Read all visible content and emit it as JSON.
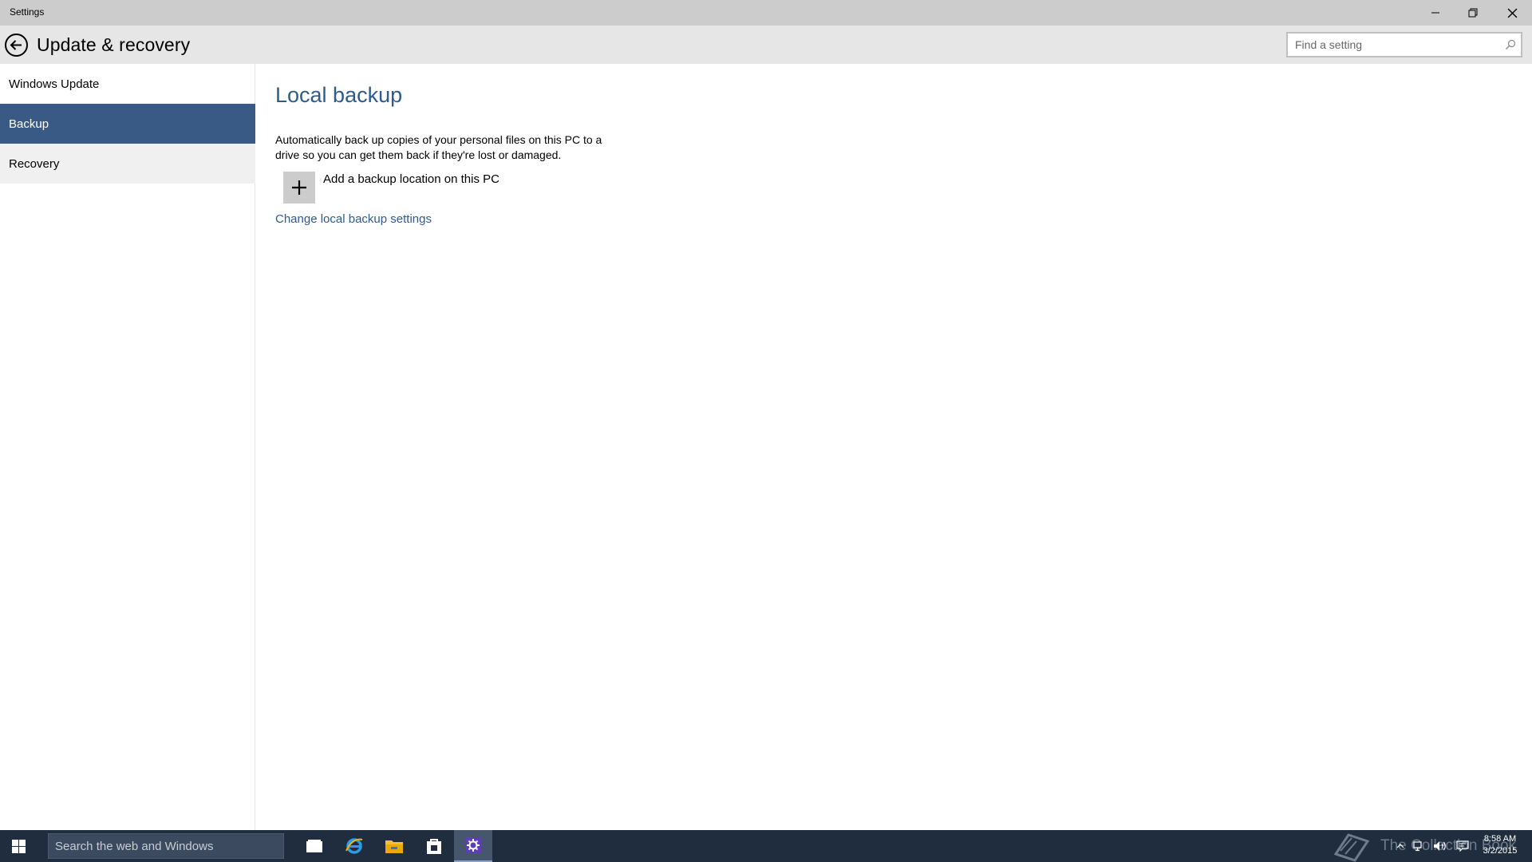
{
  "window": {
    "title": "Settings"
  },
  "header": {
    "title": "Update & recovery",
    "search_placeholder": "Find a setting"
  },
  "sidebar": {
    "items": [
      {
        "label": "Windows Update"
      },
      {
        "label": "Backup"
      },
      {
        "label": "Recovery"
      }
    ]
  },
  "main": {
    "section_title": "Local backup",
    "description": "Automatically back up copies of your personal files on this PC to a drive so you can get them back if they're lost or damaged.",
    "add_location_label": "Add a backup location on this PC",
    "change_settings_link": "Change local backup settings"
  },
  "taskbar": {
    "search_placeholder": "Search the web and Windows",
    "watermark_text": "The Collection Book",
    "clock_time": "8:58 AM",
    "clock_date": "3/2/2015"
  },
  "colors": {
    "accent": "#2d5b8c",
    "selected_nav": "#3a5a86",
    "taskbar": "#1f2d3f",
    "titlebar": "#cccccc",
    "header": "#e6e6e6"
  },
  "icons": [
    "back-arrow-icon",
    "minimize-icon",
    "restore-icon",
    "close-icon",
    "search-icon",
    "plus-icon",
    "windows-start-icon",
    "task-view-icon",
    "internet-explorer-icon",
    "file-explorer-icon",
    "store-icon",
    "settings-gear-icon",
    "book-icon",
    "chevron-up-icon",
    "network-icon",
    "volume-icon",
    "action-center-icon"
  ]
}
